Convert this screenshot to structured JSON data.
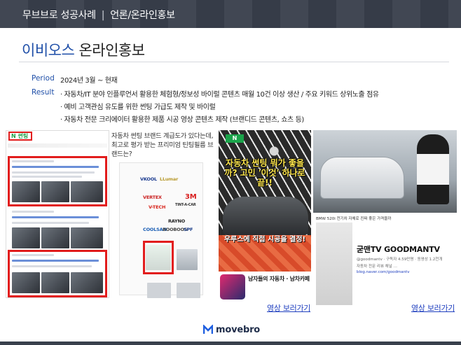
{
  "header": {
    "section": "무브브로 성공사례",
    "separator": "|",
    "subsection": "언론/온라인홍보"
  },
  "title": {
    "accent": "이비오스",
    "rest": " 온라인홍보"
  },
  "info": {
    "period_label": "Period",
    "period_value": "2024년 3월 ~ 현재",
    "result_label": "Result",
    "results": [
      "· 자동차/IT 분야 인플루언서 활용한 체험형/정보성 바이럴 콘텐츠 매월 10건 이상 생산 / 주요 키워드 상위노출 점유",
      "· 예비 고객관심 유도를 위한 썬팅 가급도 제작 및 바이럴",
      "· 자동차 전문 크리에이터 활용한 제품 시공 영상 콘텐츠 제작 (브랜디드 콘텐츠, 쇼츠 등)"
    ]
  },
  "blog": {
    "logo": "N 썬팅"
  },
  "mid": {
    "question": "자동차 썬팅 브랜드 계급도가 있다는데, 최고로 평가 받는 프리미엄 틴팅필름 브랜드는?",
    "brands": [
      "VKOOL",
      "LLumar",
      "3M",
      "VERTEX",
      "V-TECH",
      "TINT-A-CAR",
      "RAYNO",
      "COOLSAN",
      "BOOBOOS",
      "SPF"
    ]
  },
  "reel": {
    "badge": "N",
    "headline": "자동차 썬팅 뭐가 좋을까? 고민 '이것' 하나로 끝!!",
    "caption": "우루스에 직접 시공을 결정!",
    "channel": "남자들의 자동차 · 남차카페 ·"
  },
  "yt": {
    "video_title": "BMW 520i 전기차 자체로 진짜 좋은 가격을까",
    "channel_name": "굳맨TV GOODMANTV",
    "handle": "@goodmantv · 구독자 4.59만명 · 동영상 1.2천개",
    "desc": "자동차 전문 리뷰 채널 …",
    "link": "blog.naver.com/goodmantv"
  },
  "links": {
    "reel": "영상 보러가기",
    "yt": "영상 보러가기"
  },
  "footer": {
    "logo_text": "movebro"
  },
  "colors": {
    "accent": "#1f4fa8",
    "highlight": "#e21d1d",
    "header_bg": "#39404c"
  }
}
